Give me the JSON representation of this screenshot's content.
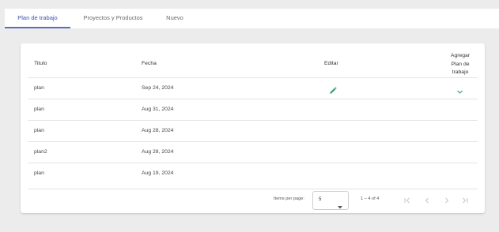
{
  "tabs": [
    {
      "label": "Plan de trabajo",
      "active": true
    },
    {
      "label": "Proyectos y Productos",
      "active": false
    },
    {
      "label": "Nuevo",
      "active": false
    }
  ],
  "table": {
    "headers": {
      "titulo": "Titulo",
      "fecha": "Fecha",
      "editar": "Editar",
      "agregar_line1": "Agregar",
      "agregar_line2": "Plan de",
      "agregar_line3": "trabajo"
    },
    "rows": [
      {
        "titulo": "plan",
        "fecha": "Sep 24, 2024"
      },
      {
        "titulo": "plan",
        "fecha": "Aug 31, 2024"
      },
      {
        "titulo": "plan",
        "fecha": "Aug 28, 2024"
      },
      {
        "titulo": "plan2",
        "fecha": "Aug 28, 2024"
      },
      {
        "titulo": "plan",
        "fecha": "Aug 19, 2024"
      }
    ]
  },
  "paginator": {
    "items_per_page_label": "Items per page:",
    "page_size": "5",
    "range_label": "1 – 4 of 4"
  },
  "colors": {
    "accent": "#3f51b5",
    "edit_icon": "#2e9e6a",
    "chevron": "#2e9e6a"
  },
  "icons": {
    "edit": "pencil-icon",
    "expand": "chevron-down-icon",
    "first_page": "first-page-icon",
    "previous_page": "chevron-left-icon",
    "next_page": "chevron-right-icon",
    "last_page": "last-page-icon",
    "select_arrow": "dropdown-arrow-icon"
  }
}
